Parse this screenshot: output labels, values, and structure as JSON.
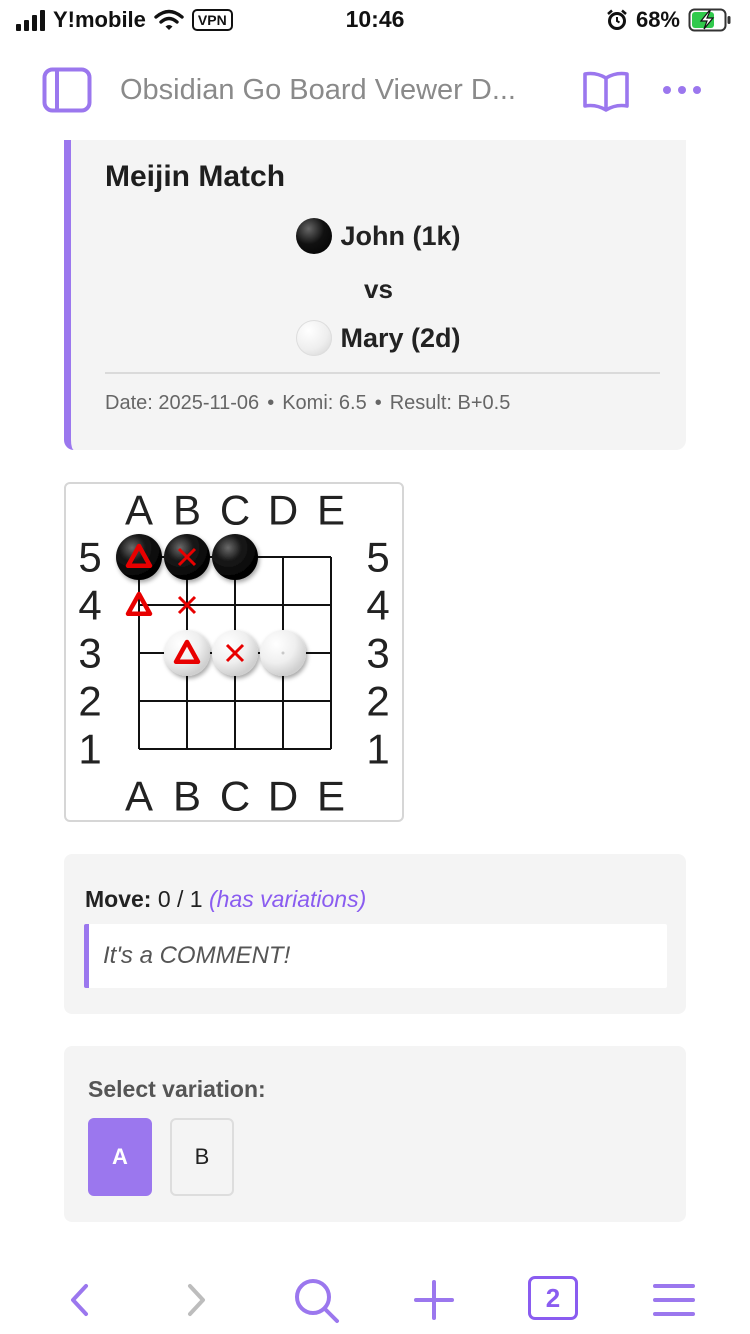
{
  "status_bar": {
    "carrier": "Y!mobile",
    "vpn": "VPN",
    "time": "10:46",
    "battery_percent": "68%"
  },
  "header": {
    "title": "Obsidian Go Board Viewer D..."
  },
  "game_info": {
    "title": "Meijin Match",
    "black_player": "John (1k)",
    "vs": "vs",
    "white_player": "Mary (2d)",
    "date": "Date: 2025-11-06",
    "komi": "Komi: 6.5",
    "result": "Result: B+0.5",
    "separator": "•"
  },
  "board": {
    "size": 5,
    "column_labels": [
      "A",
      "B",
      "C",
      "D",
      "E"
    ],
    "row_labels": [
      "5",
      "4",
      "3",
      "2",
      "1"
    ],
    "stones": [
      {
        "point": "A5",
        "color": "black",
        "marker": "triangle"
      },
      {
        "point": "B5",
        "color": "black",
        "marker": "cross"
      },
      {
        "point": "C5",
        "color": "black",
        "marker": ""
      },
      {
        "point": "B3",
        "color": "white",
        "marker": "triangle"
      },
      {
        "point": "C3",
        "color": "white",
        "marker": "cross"
      },
      {
        "point": "D3",
        "color": "white",
        "marker": "dot"
      }
    ],
    "empty_markers": [
      {
        "point": "A4",
        "marker": "triangle"
      },
      {
        "point": "B4",
        "marker": "cross"
      }
    ],
    "marker_color": "#e80000"
  },
  "move_panel": {
    "label": "Move:",
    "value": "0 / 1",
    "variations_note": "(has variations)",
    "comment": "It's a COMMENT!"
  },
  "variation_panel": {
    "label": "Select variation:",
    "options": [
      "A",
      "B"
    ],
    "selected": "A"
  },
  "toolbar": {
    "tab_count": "2"
  },
  "colors": {
    "accent": "#9b77ee",
    "accent_text": "#8a5cf0",
    "panel_bg": "#f4f4f4"
  }
}
